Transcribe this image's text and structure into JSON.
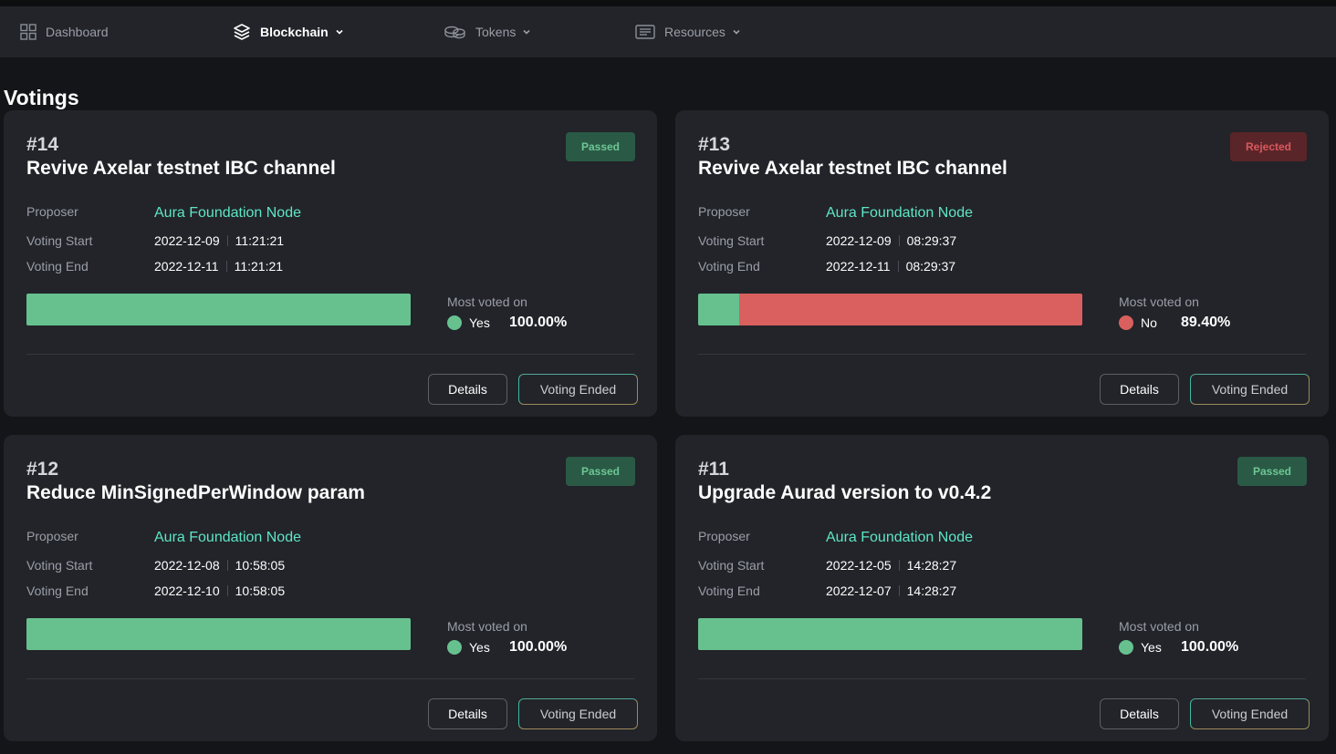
{
  "nav": {
    "items": [
      {
        "label": "Dashboard",
        "icon": "grid-icon",
        "active": false,
        "dropdown": false
      },
      {
        "label": "Blockchain",
        "icon": "layers-icon",
        "active": true,
        "dropdown": true
      },
      {
        "label": "Tokens",
        "icon": "coins-icon",
        "active": false,
        "dropdown": true
      },
      {
        "label": "Resources",
        "icon": "newspaper-icon",
        "active": false,
        "dropdown": true
      }
    ]
  },
  "page": {
    "title": "Votings"
  },
  "labels": {
    "proposer": "Proposer",
    "voting_start": "Voting Start",
    "voting_end": "Voting End",
    "most_voted_on": "Most voted on",
    "details": "Details",
    "voting_ended": "Voting Ended"
  },
  "colors": {
    "yes": "#67c18f",
    "no": "#d9605e",
    "passed_badge": "#2a5a45",
    "rejected_badge": "#5a2528",
    "proposer_link": "#5ee6c7"
  },
  "proposals": [
    {
      "number": "#14",
      "title": "Revive Axelar testnet IBC channel",
      "status": "Passed",
      "proposer": "Aura Foundation Node",
      "start_date": "2022-12-09",
      "start_time": "11:21:21",
      "end_date": "2022-12-11",
      "end_time": "11:21:21",
      "most_voted_option": "Yes",
      "most_voted_pct": "100.00%",
      "vote_shares": {
        "yes": 1.0,
        "no": 0.0
      }
    },
    {
      "number": "#13",
      "title": "Revive Axelar testnet IBC channel",
      "status": "Rejected",
      "proposer": "Aura Foundation Node",
      "start_date": "2022-12-09",
      "start_time": "08:29:37",
      "end_date": "2022-12-11",
      "end_time": "08:29:37",
      "most_voted_option": "No",
      "most_voted_pct": "89.40%",
      "vote_shares": {
        "yes": 0.106,
        "no": 0.894
      }
    },
    {
      "number": "#12",
      "title": "Reduce MinSignedPerWindow param",
      "status": "Passed",
      "proposer": "Aura Foundation Node",
      "start_date": "2022-12-08",
      "start_time": "10:58:05",
      "end_date": "2022-12-10",
      "end_time": "10:58:05",
      "most_voted_option": "Yes",
      "most_voted_pct": "100.00%",
      "vote_shares": {
        "yes": 1.0,
        "no": 0.0
      }
    },
    {
      "number": "#11",
      "title": "Upgrade Aurad version to v0.4.2",
      "status": "Passed",
      "proposer": "Aura Foundation Node",
      "start_date": "2022-12-05",
      "start_time": "14:28:27",
      "end_date": "2022-12-07",
      "end_time": "14:28:27",
      "most_voted_option": "Yes",
      "most_voted_pct": "100.00%",
      "vote_shares": {
        "yes": 1.0,
        "no": 0.0
      }
    }
  ]
}
